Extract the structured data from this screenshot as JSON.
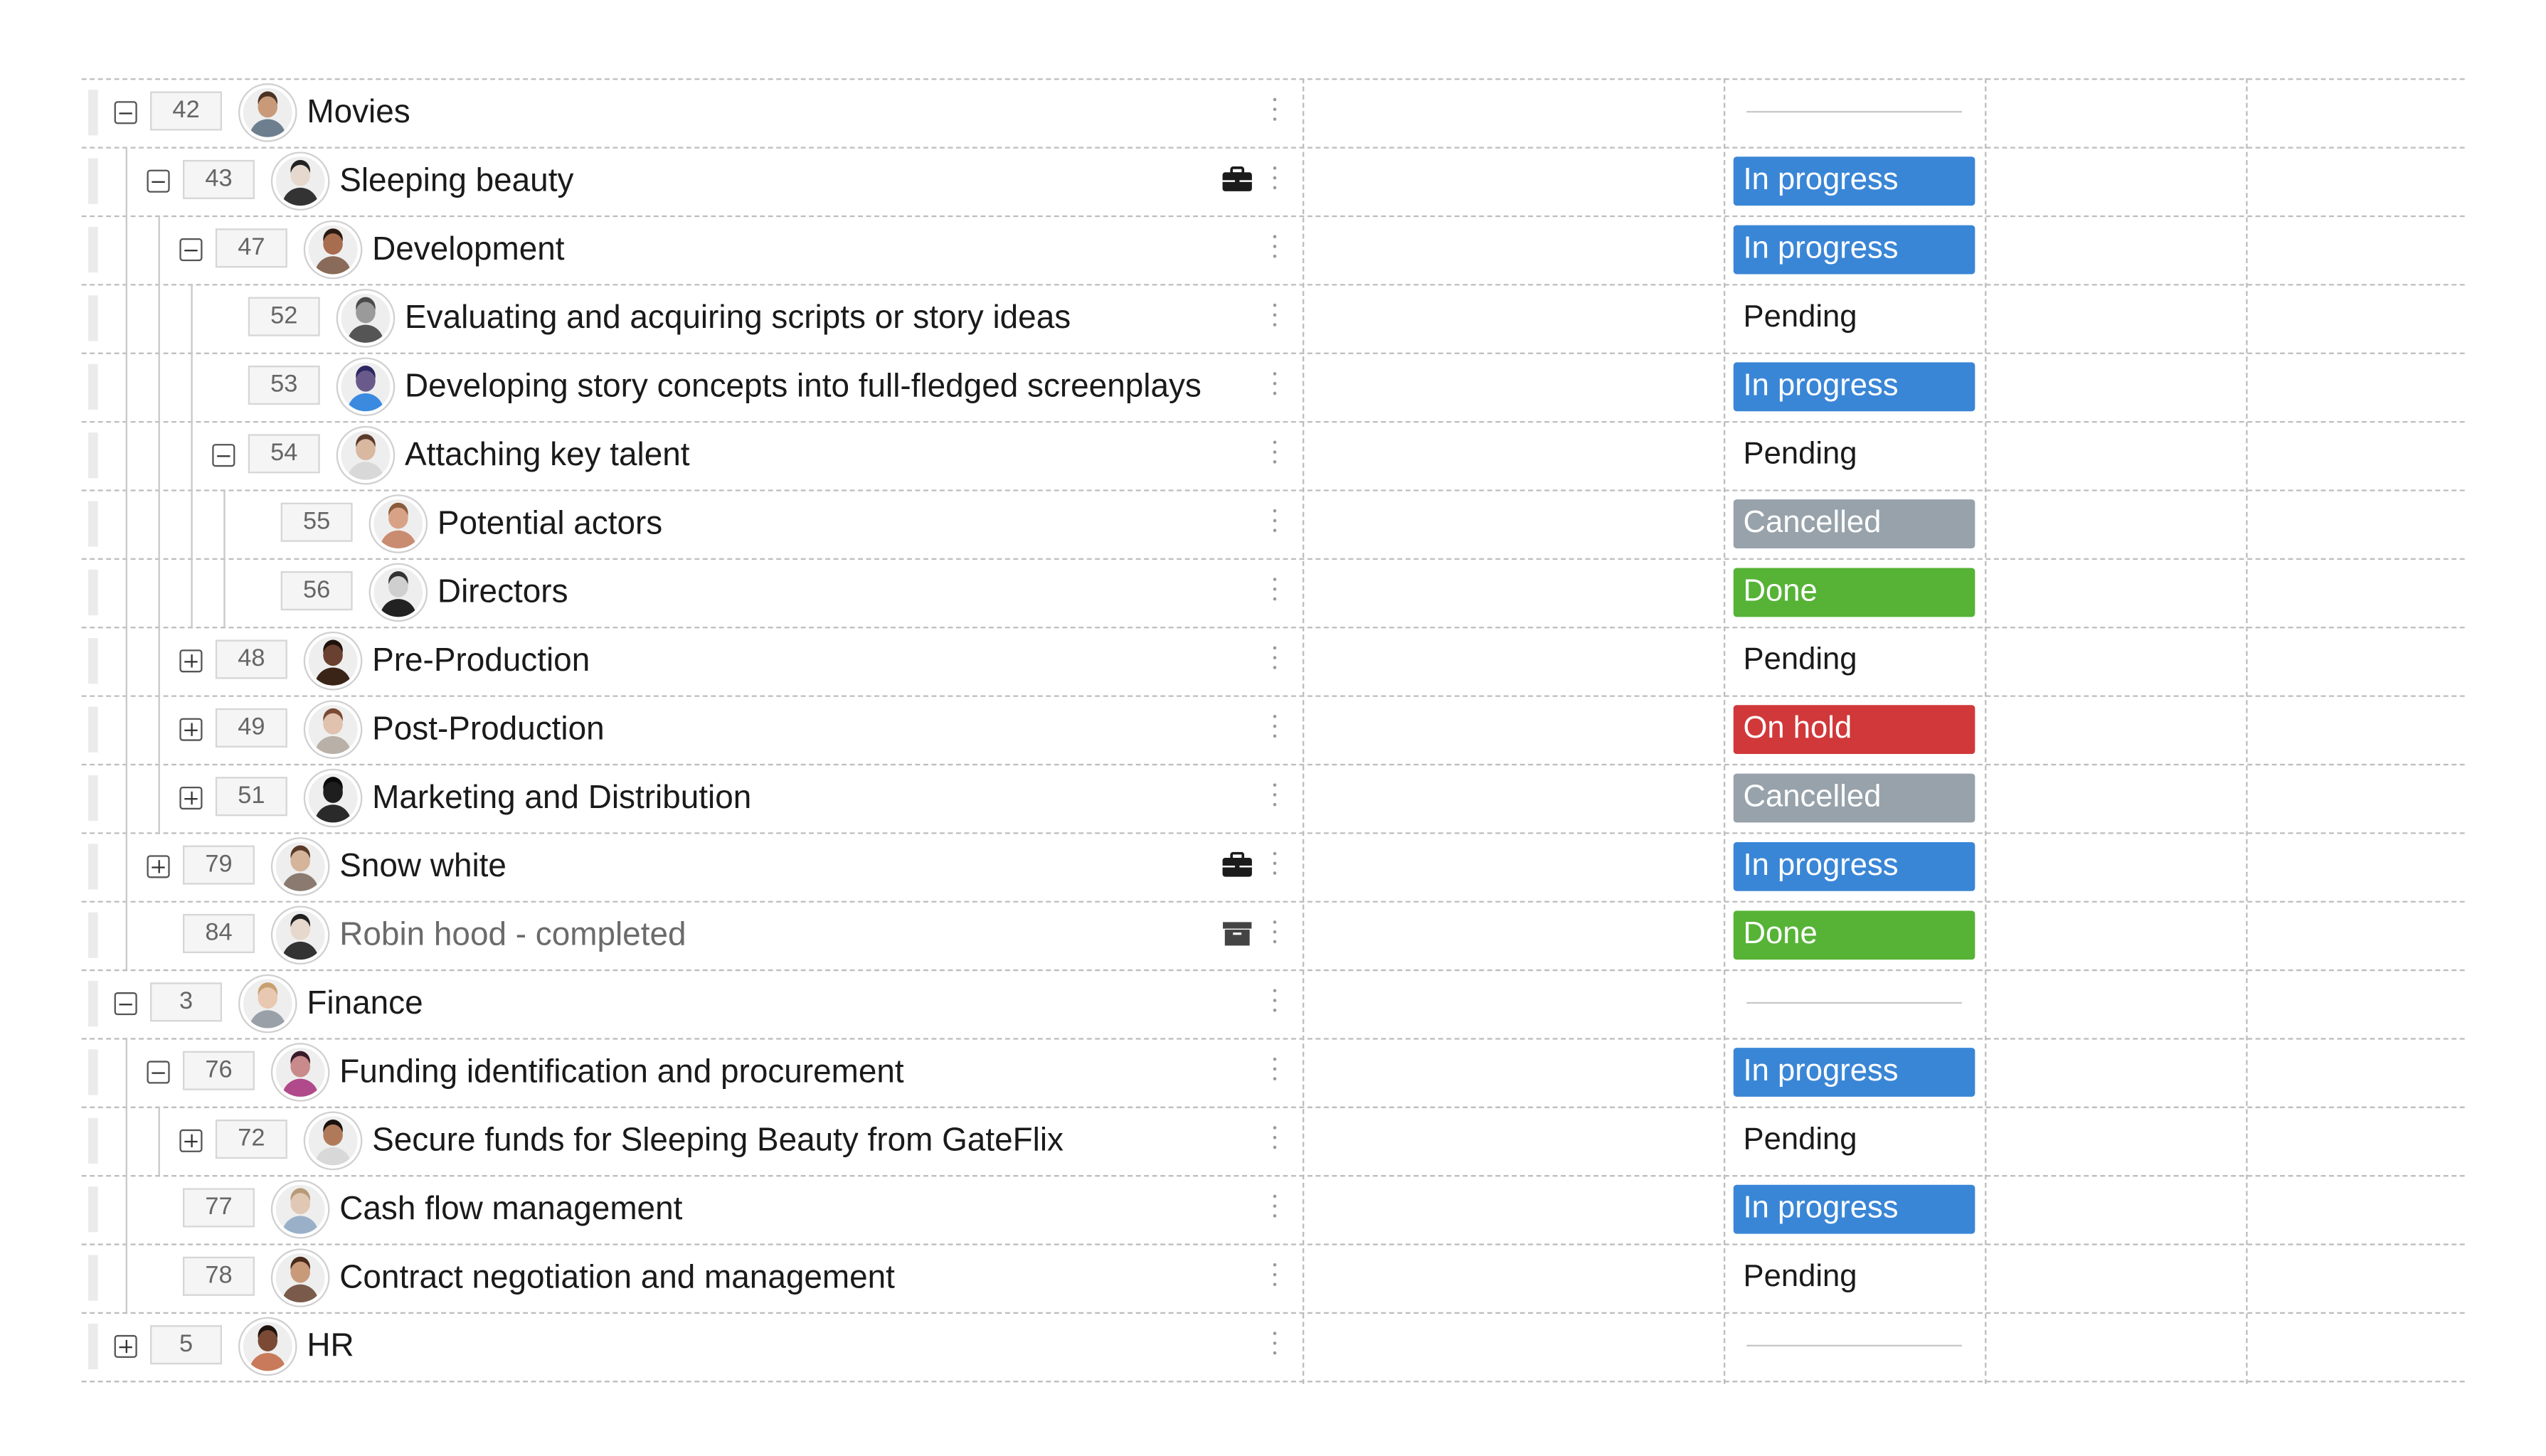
{
  "colors": {
    "in_progress": "#3a86d6",
    "cancelled": "#97a2ab",
    "done": "#56b336",
    "on_hold": "#d1383a",
    "divider": "#bdbdbd"
  },
  "status_labels": {
    "in_progress": "In progress",
    "pending": "Pending",
    "cancelled": "Cancelled",
    "done": "Done",
    "on_hold": "On hold"
  },
  "rows": [
    {
      "id": "42",
      "name": "Movies",
      "level": 0,
      "toggle": "minus",
      "status": "empty",
      "avatar": {
        "skin": "#c89a7a",
        "hair": "#4a3324",
        "shirt": "#6d7f8f"
      }
    },
    {
      "id": "43",
      "name": "Sleeping beauty",
      "level": 1,
      "toggle": "minus",
      "status": "in_progress",
      "row_icon": "briefcase-icon",
      "avatar": {
        "skin": "#e6d8cc",
        "hair": "#222222",
        "shirt": "#333333"
      }
    },
    {
      "id": "47",
      "name": "Development",
      "level": 2,
      "toggle": "minus",
      "status": "in_progress",
      "avatar": {
        "skin": "#a86c4e",
        "hair": "#2a1a12",
        "shirt": "#8a6a58"
      }
    },
    {
      "id": "52",
      "name": "Evaluating and acquiring scripts or story ideas",
      "level": 3,
      "toggle": "none",
      "status": "pending",
      "avatar": {
        "skin": "#9a9a9a",
        "hair": "#4a4a4a",
        "shirt": "#555555"
      }
    },
    {
      "id": "53",
      "name": "Developing story concepts into full-fledged screenplays",
      "level": 3,
      "toggle": "none",
      "status": "in_progress",
      "avatar": {
        "skin": "#6a5a8c",
        "hair": "#2b2560",
        "shirt": "#3a8adf"
      }
    },
    {
      "id": "54",
      "name": "Attaching key talent",
      "level": 3,
      "toggle": "minus",
      "status": "pending",
      "avatar": {
        "skin": "#d9b8a0",
        "hair": "#5a3a2a",
        "shirt": "#d8d8d8"
      }
    },
    {
      "id": "55",
      "name": "Potential actors",
      "level": 4,
      "toggle": "none",
      "status": "cancelled",
      "avatar": {
        "skin": "#d8a286",
        "hair": "#8a5a3c",
        "shirt": "#c98c70"
      }
    },
    {
      "id": "56",
      "name": "Directors",
      "level": 4,
      "toggle": "none",
      "status": "done",
      "avatar": {
        "skin": "#cfcfcf",
        "hair": "#333333",
        "shirt": "#222222"
      }
    },
    {
      "id": "48",
      "name": "Pre-Production",
      "level": 2,
      "toggle": "plus",
      "status": "pending",
      "avatar": {
        "skin": "#6a4030",
        "hair": "#1e120c",
        "shirt": "#3a2418"
      }
    },
    {
      "id": "49",
      "name": "Post-Production",
      "level": 2,
      "toggle": "plus",
      "status": "on_hold",
      "avatar": {
        "skin": "#e0c2ae",
        "hair": "#7a4a34",
        "shirt": "#b9b0a8"
      }
    },
    {
      "id": "51",
      "name": "Marketing and Distribution",
      "level": 2,
      "toggle": "plus",
      "status": "cancelled",
      "avatar": {
        "skin": "#1e1e1e",
        "hair": "#0a0a0a",
        "shirt": "#2a2a2a"
      }
    },
    {
      "id": "79",
      "name": "Snow white",
      "level": 1,
      "toggle": "plus",
      "status": "in_progress",
      "row_icon": "briefcase-icon",
      "avatar": {
        "skin": "#d4b49a",
        "hair": "#5a3a28",
        "shirt": "#8a7a70"
      }
    },
    {
      "id": "84",
      "name": "Robin hood - completed",
      "level": 1,
      "toggle": "none",
      "muted": true,
      "status": "done",
      "row_icon": "archive-icon",
      "avatar": {
        "skin": "#e6d8cc",
        "hair": "#222222",
        "shirt": "#333333"
      }
    },
    {
      "id": "3",
      "name": "Finance",
      "level": 0,
      "toggle": "minus",
      "status": "empty",
      "avatar": {
        "skin": "#e8c8b0",
        "hair": "#c8a070",
        "shirt": "#9aa0a8"
      }
    },
    {
      "id": "76",
      "name": "Funding identification and procurement",
      "level": 1,
      "toggle": "minus",
      "status": "in_progress",
      "avatar": {
        "skin": "#c88a8a",
        "hair": "#3a1a2a",
        "shirt": "#b04a8a"
      }
    },
    {
      "id": "72",
      "name": "Secure funds for Sleeping Beauty from GateFlix",
      "level": 2,
      "toggle": "plus",
      "status": "pending",
      "avatar": {
        "skin": "#b07a5a",
        "hair": "#1a1210",
        "shirt": "#d8d8d8"
      }
    },
    {
      "id": "77",
      "name": "Cash flow management",
      "level": 1,
      "toggle": "none",
      "status": "in_progress",
      "avatar": {
        "skin": "#e0c8b4",
        "hair": "#b89a78",
        "shirt": "#9ab0c8"
      }
    },
    {
      "id": "78",
      "name": "Contract negotiation and management",
      "level": 1,
      "toggle": "none",
      "status": "pending",
      "avatar": {
        "skin": "#c89a7a",
        "hair": "#4a2a1a",
        "shirt": "#7a5a4a"
      }
    },
    {
      "id": "5",
      "name": "HR",
      "level": 0,
      "toggle": "plus",
      "status": "empty",
      "avatar": {
        "skin": "#7a4a34",
        "hair": "#1e120c",
        "shirt": "#c87a5a"
      }
    }
  ]
}
